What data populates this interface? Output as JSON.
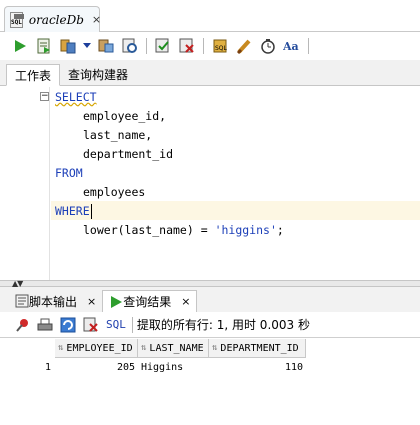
{
  "document_tab": {
    "title": "oracleDb",
    "icon_text": "SQL",
    "close": "×"
  },
  "toolbar": {
    "icons": [
      "run-statement-icon",
      "run-script-icon",
      "autotrace-icon",
      "dropdown-icon",
      "explain-plan-icon",
      "sql-tuning-icon",
      "commit-icon",
      "rollback-icon",
      "unshared-sql-icon",
      "clear-icon",
      "history-icon",
      "format-icon"
    ]
  },
  "subtabs": [
    "工作表",
    "查询构建器"
  ],
  "editor": {
    "fold_symbol": "−",
    "lines": [
      {
        "text": "SELECT",
        "type": "kw"
      },
      {
        "text": "employee_id,",
        "type": "ind"
      },
      {
        "text": "last_name,",
        "type": "ind"
      },
      {
        "text": "department_id",
        "type": "ind"
      },
      {
        "text": "FROM",
        "type": "kw"
      },
      {
        "text": "employees",
        "type": "ind"
      },
      {
        "text": "WHERE",
        "type": "kw"
      },
      {
        "text": "lower(last_name) = ",
        "type": "ind",
        "string": "'higgins'",
        "tail": ";"
      }
    ]
  },
  "output_tabs": [
    {
      "label": "脚本输出",
      "close": "×"
    },
    {
      "label": "查询结果",
      "close": "×"
    }
  ],
  "results_toolbar": {
    "sql_label": "SQL",
    "status": "提取的所有行: 1, 用时 0.003 秒"
  },
  "results": {
    "columns": [
      "EMPLOYEE_ID",
      "LAST_NAME",
      "DEPARTMENT_ID"
    ],
    "rows": [
      {
        "num": "1",
        "employee_id": "205",
        "last_name": "Higgins",
        "department_id": "110"
      }
    ]
  }
}
